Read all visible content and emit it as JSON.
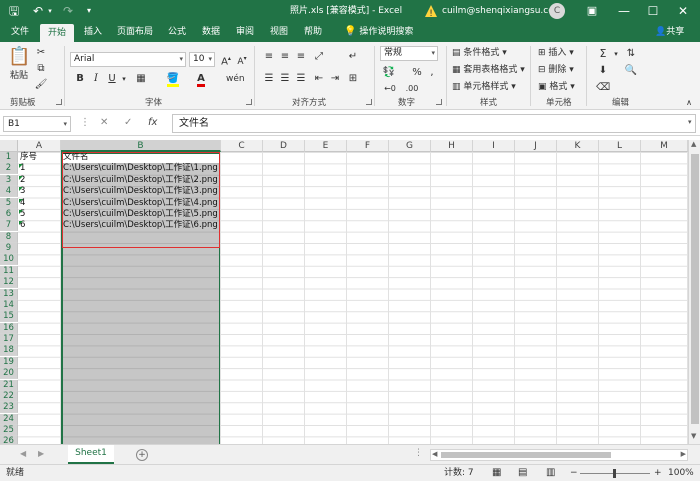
{
  "titlebar": {
    "title": "照片.xls  [兼容模式]  -  Excel",
    "account": "cuilm@shenqixiangsu.com",
    "avatar_initial": "C"
  },
  "tabs": [
    "文件",
    "开始",
    "插入",
    "页面布局",
    "公式",
    "数据",
    "审阅",
    "视图",
    "帮助"
  ],
  "tell_me": "操作说明搜索",
  "share": "共享",
  "ribbon": {
    "clipboard": {
      "label": "剪贴板",
      "paste": "粘贴"
    },
    "font": {
      "label": "字体",
      "name": "Arial",
      "size": "10"
    },
    "alignment": {
      "label": "对齐方式"
    },
    "number": {
      "label": "数字",
      "format": "常规"
    },
    "styles": {
      "label": "样式",
      "conditional": "条件格式",
      "table": "套用表格格式",
      "cell_styles": "单元格样式"
    },
    "cells": {
      "label": "单元格",
      "insert": "插入",
      "delete": "删除",
      "format": "格式"
    },
    "editing": {
      "label": "编辑"
    }
  },
  "formula_bar": {
    "name_box": "B1",
    "value": "文件名"
  },
  "columns": [
    "A",
    "B",
    "C",
    "D",
    "E",
    "F",
    "G",
    "H",
    "I",
    "J",
    "K",
    "L",
    "M"
  ],
  "rows": [
    "1",
    "2",
    "3",
    "4",
    "5",
    "6",
    "7",
    "8",
    "9",
    "10",
    "11",
    "12",
    "13",
    "14",
    "15",
    "16",
    "17",
    "18",
    "19",
    "20",
    "21",
    "22",
    "23",
    "24",
    "25",
    "26"
  ],
  "cells": {
    "A1": "序号",
    "B1": "文件名",
    "A2": "1",
    "B2": "C:\\Users\\cuilm\\Desktop\\工作证\\1.png",
    "A3": "2",
    "B3": "C:\\Users\\cuilm\\Desktop\\工作证\\2.png",
    "A4": "3",
    "B4": "C:\\Users\\cuilm\\Desktop\\工作证\\3.png",
    "A5": "4",
    "B5": "C:\\Users\\cuilm\\Desktop\\工作证\\4.png",
    "A6": "5",
    "B6": "C:\\Users\\cuilm\\Desktop\\工作证\\5.png",
    "A7": "6",
    "B7": "C:\\Users\\cuilm\\Desktop\\工作证\\6.png"
  },
  "sheet_tab": "Sheet1",
  "status": {
    "ready": "就绪",
    "count": "计数: 7",
    "zoom": "100%"
  }
}
